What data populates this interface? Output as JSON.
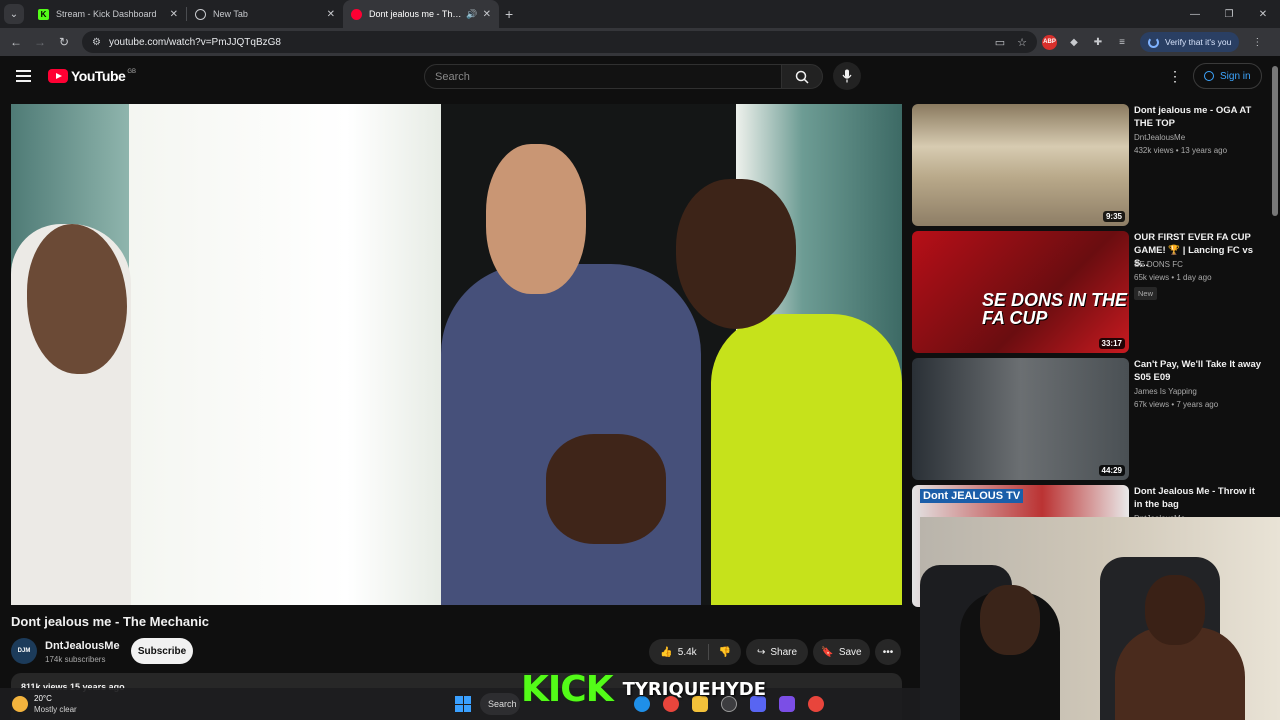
{
  "browser": {
    "tabs": [
      {
        "title": "Stream - Kick Dashboard",
        "active": false
      },
      {
        "title": "New Tab",
        "active": false
      },
      {
        "title": "Dont jealous me - The Mechanic",
        "active": true
      }
    ],
    "url": "youtube.com/watch?v=PmJJQTqBzG8",
    "verify_label": "Verify that it's you",
    "abp_label": "ABP"
  },
  "youtube": {
    "logo_text": "YouTube",
    "country_code": "GB",
    "search_placeholder": "Search",
    "signin_label": "Sign in"
  },
  "video": {
    "title": "Dont jealous me - The Mechanic",
    "channel": "DntJealousMe",
    "subscribers": "174k subscribers",
    "subscribe_label": "Subscribe",
    "likes": "5.4k",
    "share_label": "Share",
    "save_label": "Save",
    "views_line": "811k views  15 years ago",
    "avatar_text": "DJM"
  },
  "recommendations": [
    {
      "title": "Dont jealous me - OGA AT THE TOP",
      "channel": "DntJealousMe",
      "meta": "432k views • 13 years ago",
      "duration": "9:35",
      "badge": ""
    },
    {
      "title": "OUR FIRST EVER FA CUP GAME! 🏆 | Lancing FC vs S...",
      "channel": "SE DONS FC",
      "meta": "65k views • 1 day ago",
      "duration": "33:17",
      "badge": "New",
      "thumb_text": "SE DONS IN THE FA CUP"
    },
    {
      "title": "Can't Pay, We'll Take It away S05 E09",
      "channel": "James Is Yapping",
      "meta": "67k views • 7 years ago",
      "duration": "44:29",
      "badge": ""
    },
    {
      "title": "Dont Jealous Me - Throw it in the bag",
      "channel": "DntJealousMe",
      "meta": "",
      "duration": "",
      "badge": "",
      "thumb_text": "Dont JEALOUS TV"
    }
  ],
  "overlay": {
    "brand": "KICK",
    "username": "TYRIQUEHYDE"
  },
  "taskbar": {
    "temperature": "20°C",
    "weather": "Mostly clear",
    "search_label": "Search"
  }
}
